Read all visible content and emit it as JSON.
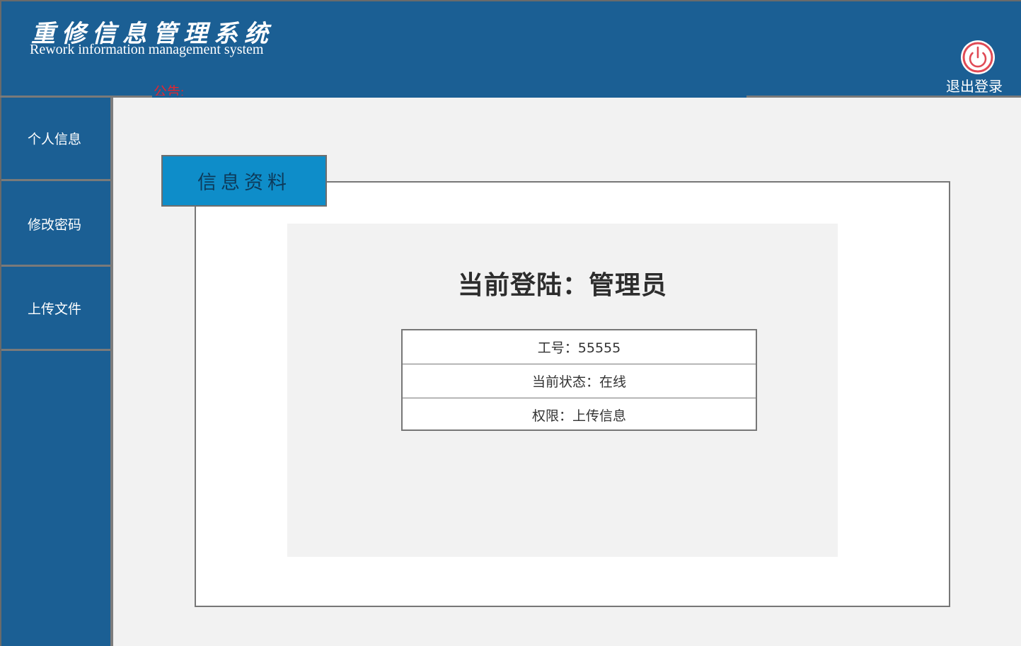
{
  "header": {
    "title_cn": "重修信息管理系统",
    "title_en": "Rework information management system",
    "notice_label": "公告:",
    "logout_label": "退出登录",
    "logout_icon": "power-icon"
  },
  "sidebar": {
    "items": [
      {
        "label": "个人信息"
      },
      {
        "label": "修改密码"
      },
      {
        "label": "上传文件"
      }
    ]
  },
  "main": {
    "tab_label": "信息资料",
    "login_title": "当前登陆：管理员",
    "info_rows": [
      {
        "text": "工号：55555"
      },
      {
        "text": "当前状态：在线"
      },
      {
        "text": "权限：上传信息"
      }
    ]
  },
  "colors": {
    "primary": "#1b5f94",
    "tab": "#0e8dc9",
    "notice": "#e8242c",
    "logout_ring": "#e04a55"
  }
}
